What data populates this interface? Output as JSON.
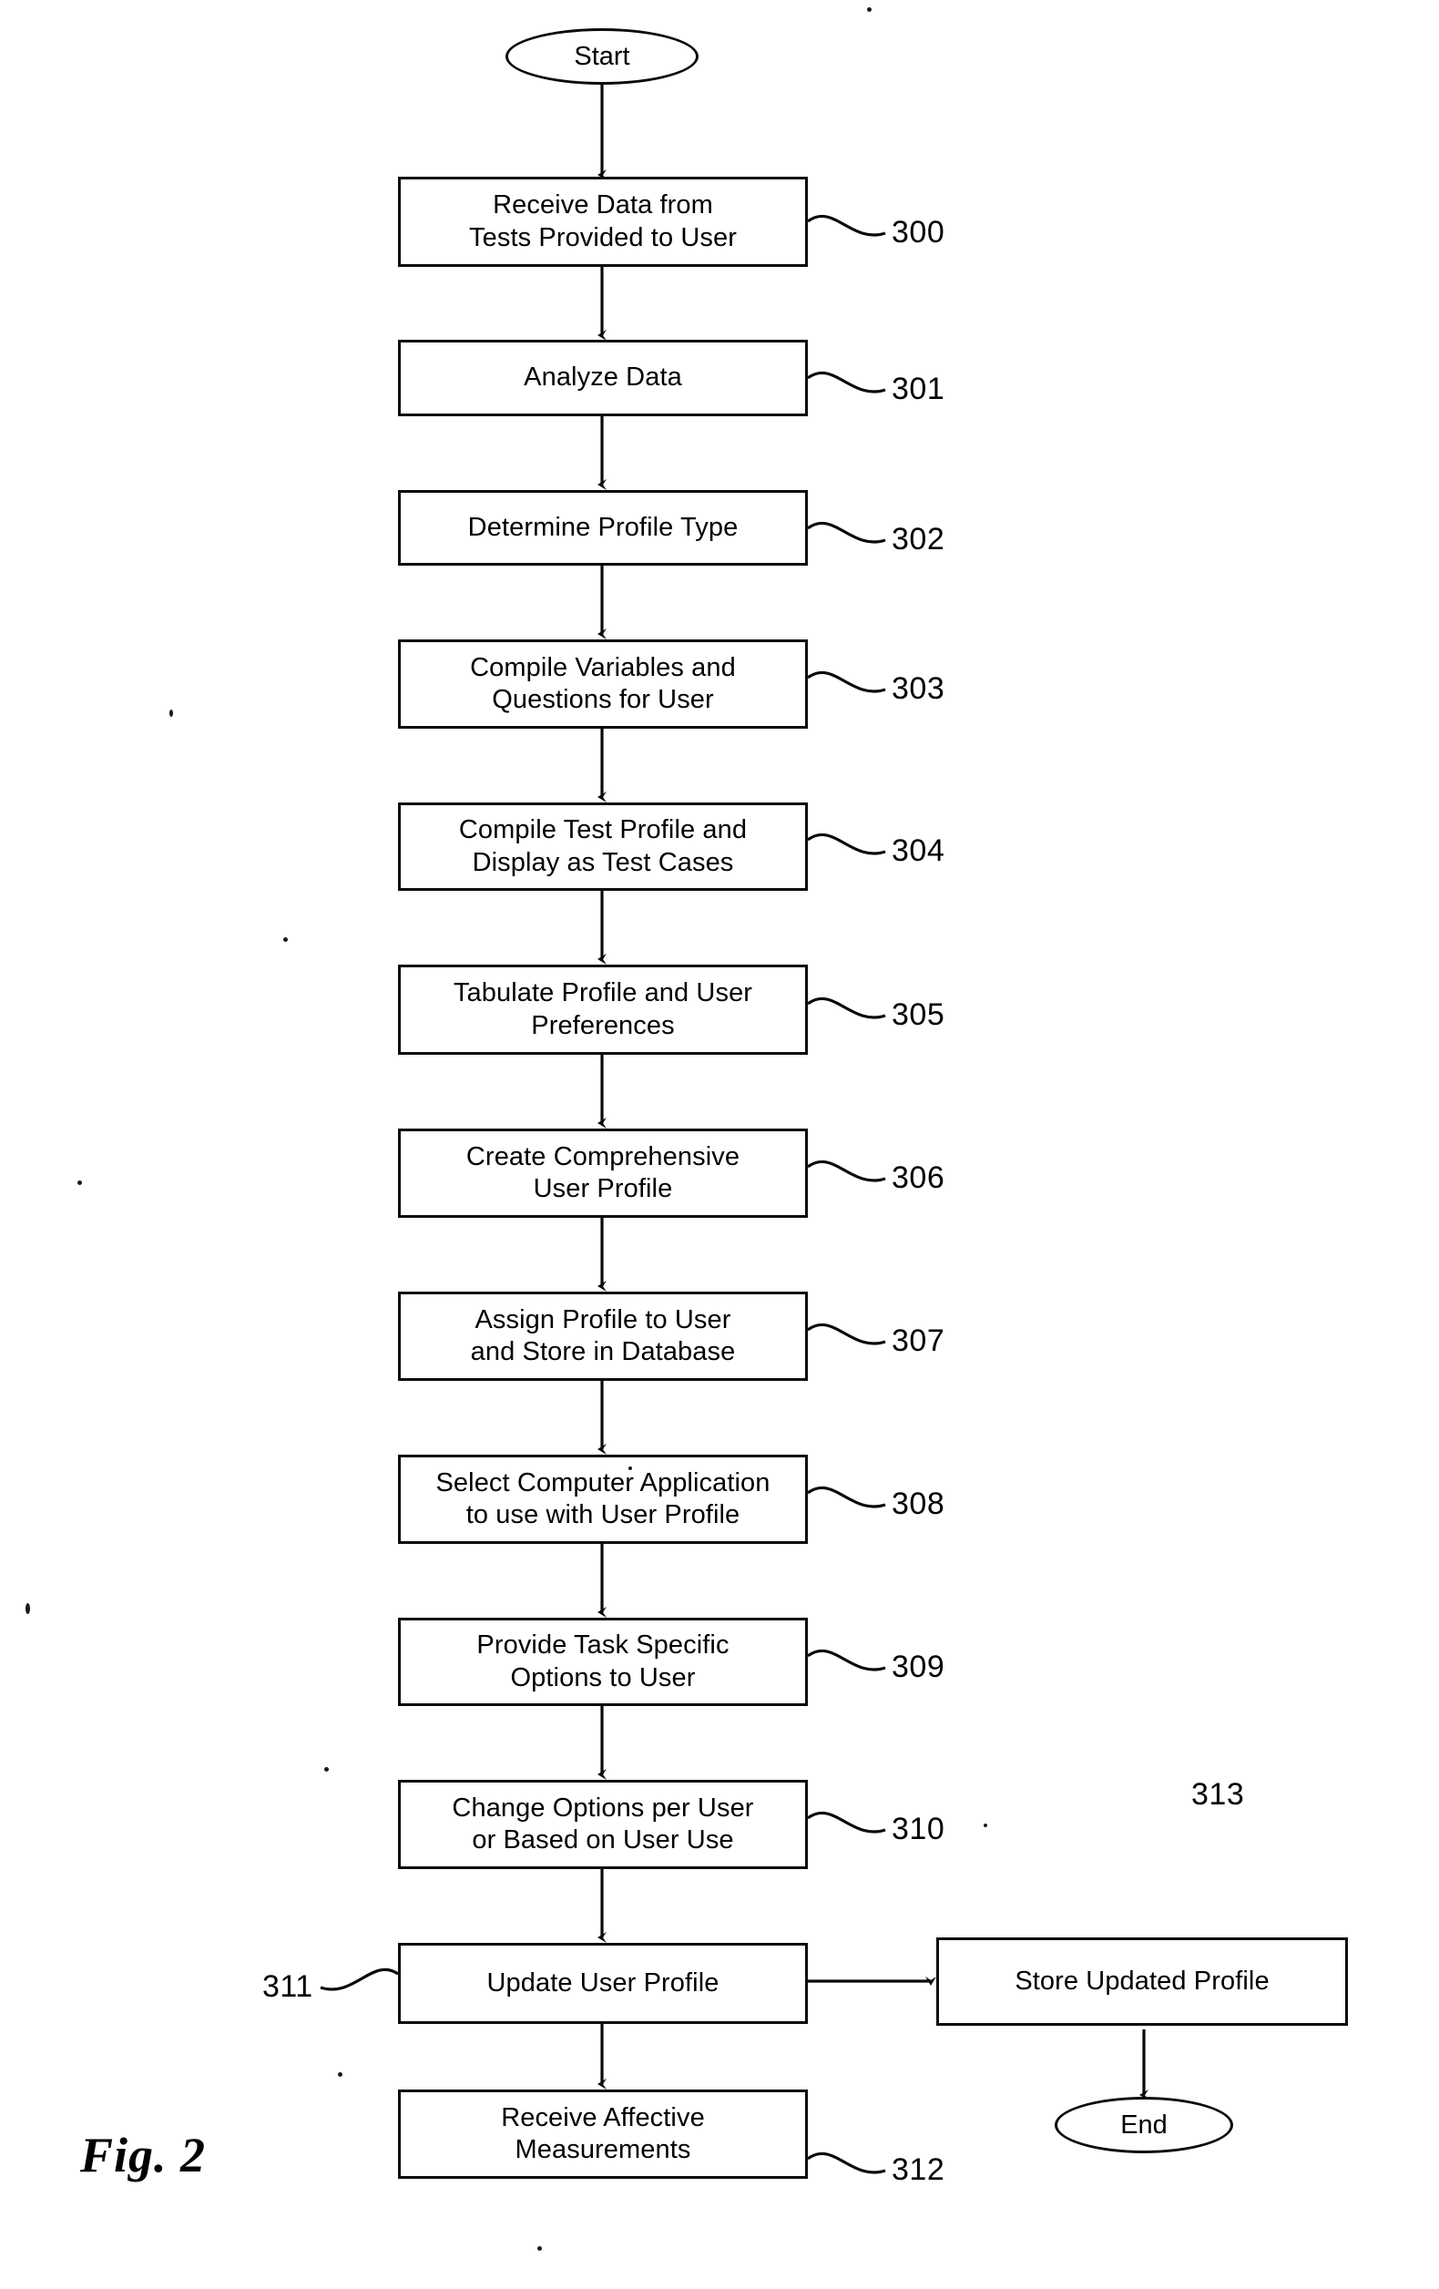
{
  "figure": {
    "caption": "Fig. 2",
    "type": "patent-flowchart"
  },
  "terminators": [
    {
      "id": "start",
      "label": "Start"
    },
    {
      "id": "end",
      "label": "End"
    }
  ],
  "steps": [
    {
      "ref": "300",
      "label": "Receive Data from\nTests Provided to User"
    },
    {
      "ref": "301",
      "label": "Analyze Data"
    },
    {
      "ref": "302",
      "label": "Determine Profile Type"
    },
    {
      "ref": "303",
      "label": "Compile Variables and\nQuestions for User"
    },
    {
      "ref": "304",
      "label": "Compile Test Profile and\nDisplay as Test Cases"
    },
    {
      "ref": "305",
      "label": "Tabulate Profile and User\nPreferences"
    },
    {
      "ref": "306",
      "label": "Create Comprehensive\nUser Profile"
    },
    {
      "ref": "307",
      "label": "Assign Profile to User\nand Store in Database"
    },
    {
      "ref": "308",
      "label": "Select Computer Application\nto use with User Profile"
    },
    {
      "ref": "309",
      "label": "Provide Task Specific\nOptions to User"
    },
    {
      "ref": "310",
      "label": "Change Options per User\nor Based on User Use"
    },
    {
      "ref": "311",
      "label": "Update User Profile"
    },
    {
      "ref": "312",
      "label": "Receive Affective\nMeasurements"
    },
    {
      "ref": "313",
      "label": "Store Updated Profile"
    }
  ],
  "reference_numerals": {
    "n300": "300",
    "n301": "301",
    "n302": "302",
    "n303": "303",
    "n304": "304",
    "n305": "305",
    "n306": "306",
    "n307": "307",
    "n308": "308",
    "n309": "309",
    "n310": "310",
    "n311": "311",
    "n312": "312",
    "n313": "313"
  },
  "colors": {
    "ink": "#0a0a0a",
    "paper": "#ffffff"
  }
}
